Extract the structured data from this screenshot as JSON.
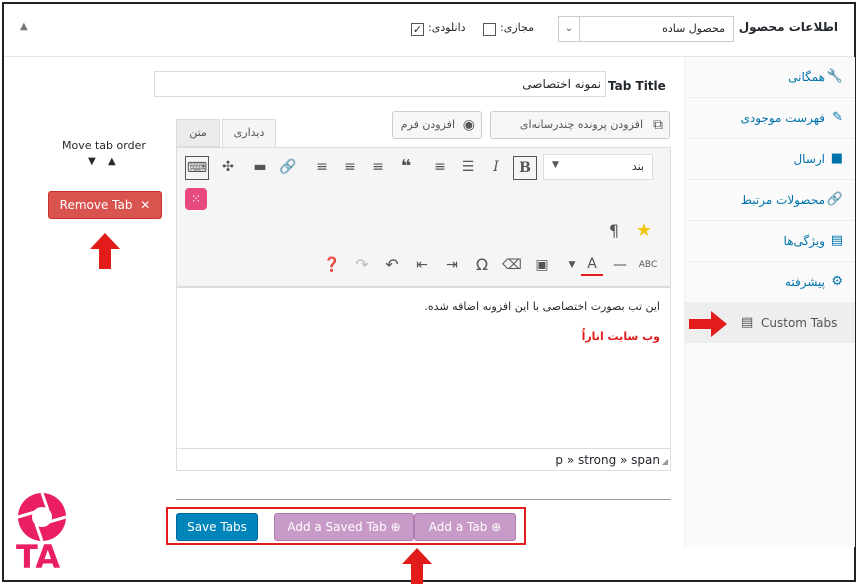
{
  "header": {
    "title": "اطلاعات محصول —",
    "product_type": "محصول ساده",
    "virtual_label": "مجازی:",
    "downloadable_label": "دانلودی:",
    "downloadable_checked": "✓"
  },
  "sidebar": {
    "items": [
      {
        "label": "همگانی",
        "icon": "wrench-icon"
      },
      {
        "label": "فهرست موجودی",
        "icon": "tag-icon"
      },
      {
        "label": "ارسال",
        "icon": "truck-icon"
      },
      {
        "label": "محصولات مرتبط",
        "icon": "link-icon"
      },
      {
        "label": "ویژگی‌ها",
        "icon": "list-icon"
      },
      {
        "label": "پیشرفته",
        "icon": "gear-icon"
      },
      {
        "label": "Custom Tabs",
        "icon": "table-icon"
      }
    ]
  },
  "tab_title": {
    "label": "Tab Title",
    "value": "نمونه اختصاصی"
  },
  "media": {
    "add_media": "افزودن پرونده چندرسانه‌ای",
    "add_form": "افزودن فرم"
  },
  "editor_tabs": {
    "visual": "دیداری",
    "text": "متن"
  },
  "toolbar": {
    "format": "بند"
  },
  "editor": {
    "line1": "این تب بصورت اختصاصی با این افزونه اضافه شده.",
    "line2": "وب سایت اناراُ",
    "path": "p » strong » span"
  },
  "move": {
    "label": "Move tab order",
    "down": "▼",
    "up": "▲"
  },
  "buttons": {
    "remove": "Remove Tab",
    "save": "Save Tabs",
    "add_saved": "Add a Saved Tab",
    "add": "Add a Tab"
  },
  "logo": {
    "text": "TA"
  },
  "colors": {
    "accent": "#0073aa",
    "remove": "#d9534f",
    "save": "#0085ba",
    "purple": "#c89ac8",
    "arrow": "#e21b1b"
  }
}
